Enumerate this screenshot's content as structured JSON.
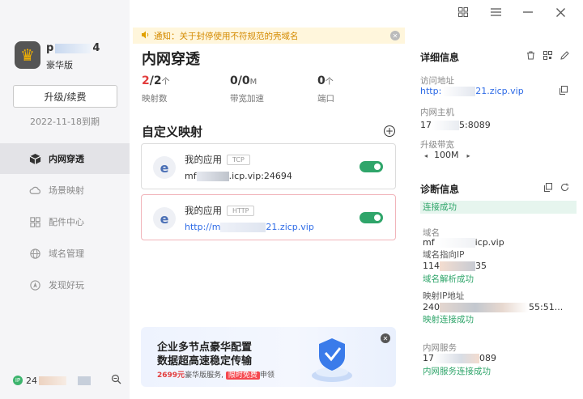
{
  "window": {
    "icons": [
      "grid-icon",
      "menu-icon",
      "minimize-icon",
      "close-icon"
    ]
  },
  "sidebar": {
    "username_start": "p",
    "username_end": "4",
    "edition": "豪华版",
    "upgrade_label": "升级/续费",
    "expire_text": "2022-11-18到期",
    "items": [
      {
        "label": "内网穿透",
        "icon": "cube-icon",
        "active": true
      },
      {
        "label": "场景映射",
        "icon": "cloud-icon",
        "active": false
      },
      {
        "label": "配件中心",
        "icon": "apps-icon",
        "active": false
      },
      {
        "label": "域名管理",
        "icon": "globe-icon",
        "active": false
      },
      {
        "label": "发现好玩",
        "icon": "compass-icon",
        "active": false
      }
    ],
    "bottom_ip": "24"
  },
  "main": {
    "notice": "通知：关于封停使用不符规范的壳域名",
    "title": "内网穿透",
    "stats": [
      {
        "value_hl": "2",
        "value_rest": "/2",
        "unit": "个",
        "label": "映射数"
      },
      {
        "value_hl": "",
        "value_rest": "0/0",
        "unit": "M",
        "label": "带宽加速"
      },
      {
        "value_hl": "",
        "value_rest": "0",
        "unit": "个",
        "label": "端口"
      }
    ],
    "section_title": "自定义映射",
    "mappings": [
      {
        "name": "我的应用",
        "protocol": "TCP",
        "addr_prefix": "mf",
        "addr_suffix": ".icp.vip:24694",
        "enabled": true
      },
      {
        "name": "我的应用",
        "protocol": "HTTP",
        "addr_prefix": "http://m",
        "addr_suffix": "21.zicp.vip",
        "enabled": true
      }
    ],
    "banner": {
      "line1": "企业多节点豪华配置",
      "line2": "数据超高速稳定传输",
      "price": "2699元",
      "mid": "豪华版服务,",
      "free": "限时免费",
      "tail": "申领"
    }
  },
  "detail": {
    "title": "详细信息",
    "access_label": "访问地址",
    "access_prefix": "http:",
    "access_suffix": "21.zicp.vip",
    "host_label": "内网主机",
    "host_prefix": "17",
    "host_suffix": "5:8089",
    "bandwidth_label": "升级带宽",
    "bandwidth_value": "100M"
  },
  "diagnosis": {
    "title": "诊断信息",
    "status": "连接成功",
    "domain_label": "域名",
    "domain_prefix": "mf",
    "domain_suffix": "icp.vip",
    "domain_ip_label": "域名指向IP",
    "domain_ip_prefix": "114",
    "domain_ip_suffix": "35",
    "domain_resolve_ok": "域名解析成功",
    "map_ip_label": "映射IP地址",
    "map_ip_prefix": "240",
    "map_ip_suffix": "55:51...",
    "map_conn_ok": "映射连接成功",
    "lan_label": "内网服务",
    "lan_prefix": "17",
    "lan_suffix": "089",
    "lan_conn_ok": "内网服务连接成功"
  }
}
